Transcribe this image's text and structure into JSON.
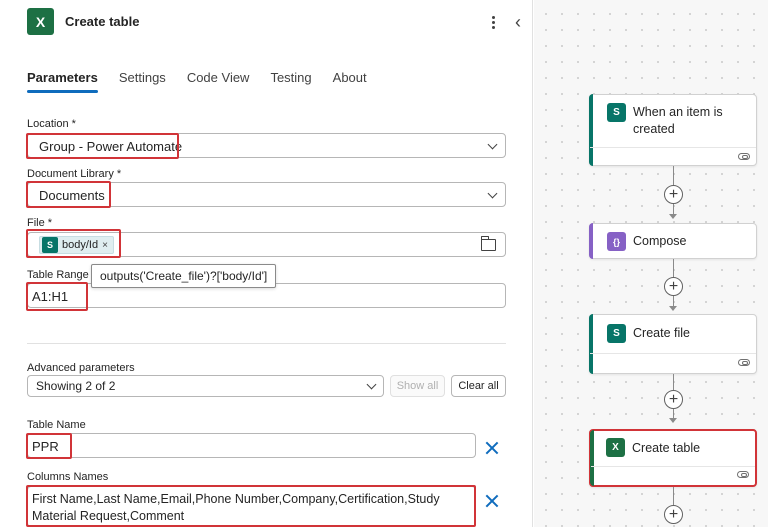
{
  "panel": {
    "title": "Create table",
    "icon": "excel-icon",
    "tabs": [
      {
        "label": "Parameters",
        "active": true
      },
      {
        "label": "Settings",
        "active": false
      },
      {
        "label": "Code View",
        "active": false
      },
      {
        "label": "Testing",
        "active": false
      },
      {
        "label": "About",
        "active": false
      }
    ]
  },
  "fields": {
    "location": {
      "label": "Location *",
      "value": "Group - Power Automate"
    },
    "library": {
      "label": "Document Library *",
      "value": "Documents"
    },
    "file": {
      "label": "File *",
      "token": "body/Id",
      "token_remove": "×"
    },
    "range": {
      "label": "Table Range *",
      "value": "A1:H1",
      "tooltip": "outputs('Create_file')?['body/Id']"
    },
    "advanced": {
      "label": "Advanced parameters",
      "value": "Showing 2 of 2",
      "show_all": "Show all",
      "clear_all": "Clear all"
    },
    "table_name": {
      "label": "Table Name",
      "value": "PPR"
    },
    "columns": {
      "label": "Columns Names",
      "value": "First Name,Last Name,Email,Phone Number,Company,Certification,Study Material Request,Comment"
    }
  },
  "flow": {
    "cards": [
      {
        "title": "When an item is created",
        "icon": "sharepoint-icon",
        "color": "#077568"
      },
      {
        "title": "Compose",
        "icon": "compose-icon",
        "color": "#8661c5"
      },
      {
        "title": "Create file",
        "icon": "sharepoint-icon",
        "color": "#077568"
      },
      {
        "title": "Create table",
        "icon": "excel-icon",
        "color": "#1d7044"
      }
    ]
  },
  "colors": {
    "accent": "#0f6cbd",
    "highlight": "#d13438"
  }
}
